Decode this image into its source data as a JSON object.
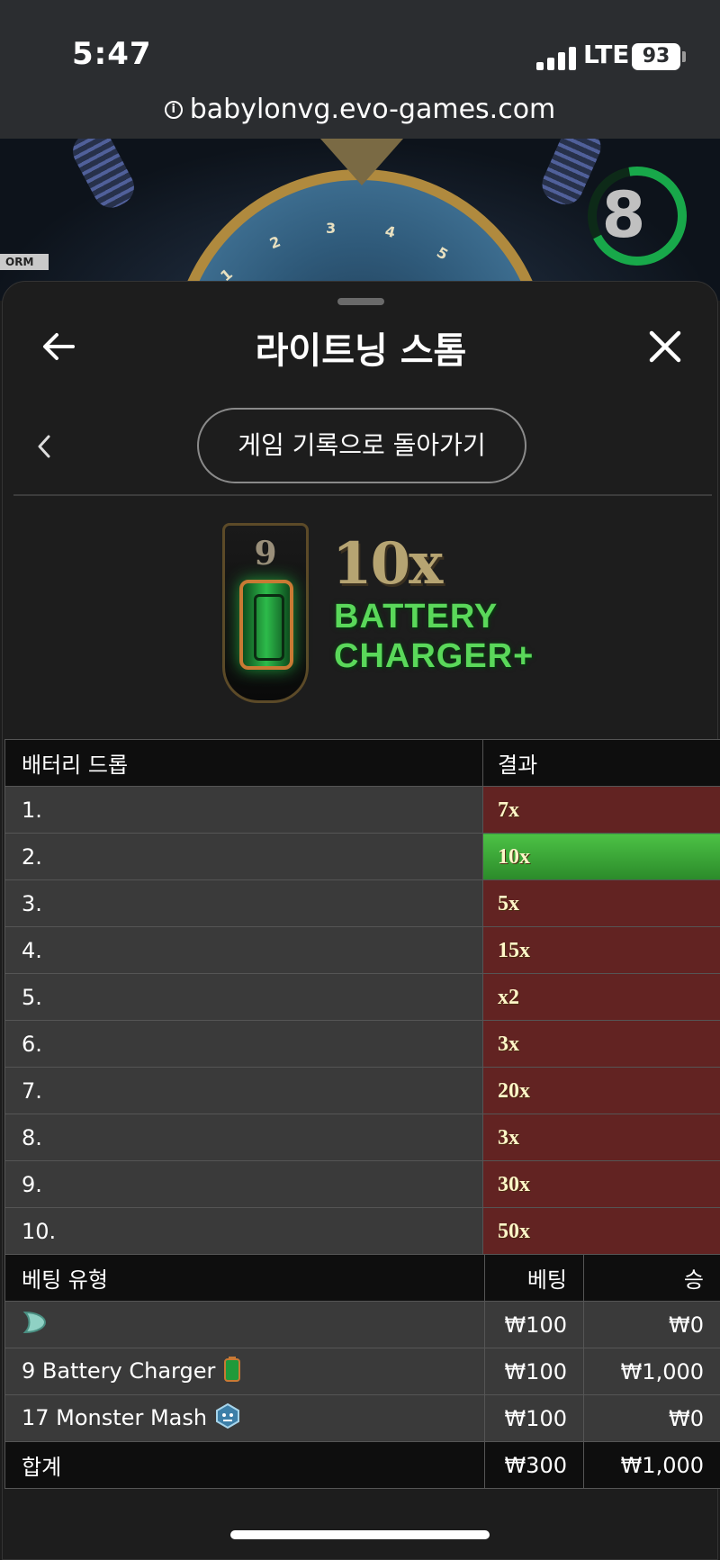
{
  "status_bar": {
    "time": "5:47",
    "network": "LTE",
    "battery": "93"
  },
  "browser": {
    "url": "babylonvg.evo-games.com"
  },
  "game": {
    "wheel_numbers": [
      "1",
      "2",
      "3",
      "4",
      "5"
    ],
    "form_tag": "ORM",
    "timer_value": "8",
    "colors": {
      "timer_ring": "#18a84a",
      "wheel_rim": "#b08a3e"
    }
  },
  "modal": {
    "title": "라이트닝 스톰",
    "back_to_history_label": "게임 기록으로 돌아가기",
    "result": {
      "slot_number": "9",
      "multiplier": "10x",
      "bonus_line1": "BATTERY",
      "bonus_line2": "CHARGER+"
    },
    "drops_table": {
      "headers": [
        "배터리 드롭",
        "결과"
      ],
      "rows": [
        {
          "index": "1.",
          "result": "7x"
        },
        {
          "index": "2.",
          "result": "10x"
        },
        {
          "index": "3.",
          "result": "5x"
        },
        {
          "index": "4.",
          "result": "15x"
        },
        {
          "index": "5.",
          "result": "x2"
        },
        {
          "index": "6.",
          "result": "3x"
        },
        {
          "index": "7.",
          "result": "20x"
        },
        {
          "index": "8.",
          "result": "3x"
        },
        {
          "index": "9.",
          "result": "30x"
        },
        {
          "index": "10.",
          "result": "50x"
        }
      ],
      "winning_row": "2.",
      "colors": {
        "loss": "#622322",
        "win": "#3fae3a"
      }
    },
    "bets_table": {
      "headers": [
        "베팅 유형",
        "베팅",
        "승"
      ],
      "rows": [
        {
          "type": "",
          "icon": "leaf-arrow-icon",
          "bet": "₩100",
          "win": "₩0"
        },
        {
          "type": "9 Battery Charger",
          "icon": "battery-icon",
          "bet": "₩100",
          "win": "₩1,000"
        },
        {
          "type": "17 Monster Mash",
          "icon": "monster-icon",
          "bet": "₩100",
          "win": "₩0"
        }
      ],
      "total": {
        "label": "합계",
        "bet": "₩300",
        "win": "₩1,000"
      }
    }
  }
}
